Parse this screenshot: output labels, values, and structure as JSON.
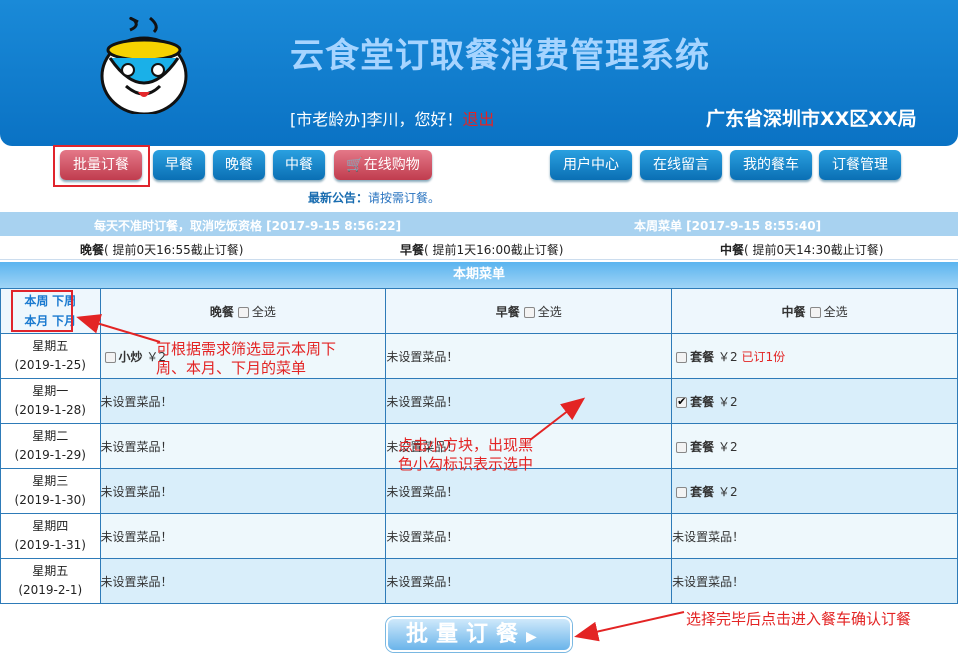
{
  "header": {
    "title": "云食堂订取餐消费管理系统",
    "greeting_prefix": "[市老龄办]李川，您好！",
    "logout": "退出",
    "region": "广东省深圳市XX区XX局"
  },
  "nav": {
    "batch": "批量订餐",
    "breakfast": "早餐",
    "dinner": "晚餐",
    "lunch": "中餐",
    "shop": "在线购物",
    "user_center": "用户中心",
    "message": "在线留言",
    "cart": "我的餐车",
    "order_mgmt": "订餐管理"
  },
  "notice": {
    "label": "最新公告：",
    "text": "请按需订餐。"
  },
  "info": {
    "left": "每天不准时订餐，取消吃饭资格 [2017-9-15 8:56:22]",
    "right": "本周菜单 [2017-9-15 8:55:40]"
  },
  "deadlines": [
    {
      "meal": "晚餐",
      "text": "( 提前0天16:55截止订餐)"
    },
    {
      "meal": "早餐",
      "text": "( 提前1天16:00截止订餐)"
    },
    {
      "meal": "中餐",
      "text": "( 提前0天14:30截止订餐)"
    }
  ],
  "menu_title": "本期菜单",
  "filters": {
    "this_week": "本周",
    "next_week": "下周",
    "this_month": "本月",
    "next_month": "下月"
  },
  "columns": [
    {
      "meal": "晚餐",
      "all": "全选"
    },
    {
      "meal": "早餐",
      "all": "全选"
    },
    {
      "meal": "中餐",
      "all": "全选"
    }
  ],
  "rows": [
    {
      "day": "星期五",
      "date": "(2019-1-25)",
      "cells": [
        {
          "dish": "小炒",
          "price": "￥2"
        },
        {
          "empty": "未设置菜品！"
        },
        {
          "dish": "套餐",
          "price": "￥2",
          "ordered": "已订1份"
        }
      ]
    },
    {
      "day": "星期一",
      "date": "(2019-1-28)",
      "cells": [
        {
          "empty": "未设置菜品！"
        },
        {
          "empty": "未设置菜品！"
        },
        {
          "dish": "套餐",
          "price": "￥2",
          "checked": true
        }
      ]
    },
    {
      "day": "星期二",
      "date": "(2019-1-29)",
      "cells": [
        {
          "empty": "未设置菜品！"
        },
        {
          "empty": "未设置菜品！"
        },
        {
          "dish": "套餐",
          "price": "￥2"
        }
      ]
    },
    {
      "day": "星期三",
      "date": "(2019-1-30)",
      "cells": [
        {
          "empty": "未设置菜品！"
        },
        {
          "empty": "未设置菜品！"
        },
        {
          "dish": "套餐",
          "price": "￥2"
        }
      ]
    },
    {
      "day": "星期四",
      "date": "(2019-1-31)",
      "cells": [
        {
          "empty": "未设置菜品！"
        },
        {
          "empty": "未设置菜品！"
        },
        {
          "empty": "未设置菜品！"
        }
      ]
    },
    {
      "day": "星期五",
      "date": "(2019-2-1)",
      "cells": [
        {
          "empty": "未设置菜品！"
        },
        {
          "empty": "未设置菜品！"
        },
        {
          "empty": "未设置菜品！"
        }
      ]
    }
  ],
  "annotations": {
    "filter": "可根据需求筛选显示本周下周、本月、下月的菜单",
    "checkbox": "点击小方块，出现黑色小勾标识表示选中",
    "submit": "选择完毕后点击进入餐车确认订餐"
  },
  "submit_button": "批量订餐",
  "colors": {
    "header": "#0a72c4",
    "accent_red": "#e32424"
  }
}
